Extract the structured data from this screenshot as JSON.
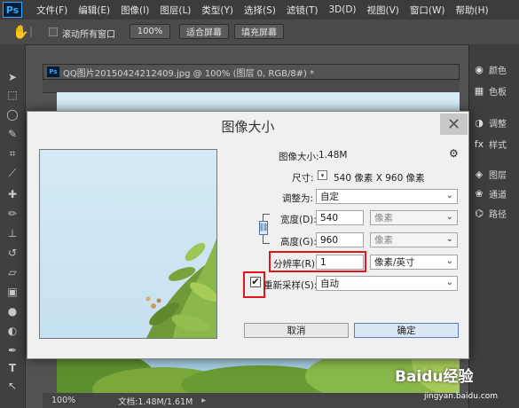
{
  "app": {
    "logo": "Ps"
  },
  "menu": [
    "文件(F)",
    "编辑(E)",
    "图像(I)",
    "图层(L)",
    "类型(Y)",
    "选择(S)",
    "滤镜(T)",
    "3D(D)",
    "视图(V)",
    "窗口(W)",
    "帮助(H)"
  ],
  "options_bar": {
    "scroll_all_label": "滚动所有窗口",
    "zoom_label": "100%",
    "fit_screen_label": "适合屏幕",
    "fill_screen_label": "填充屏幕"
  },
  "right_panels": [
    "颜色",
    "色板",
    "调整",
    "样式",
    "图层",
    "通道",
    "路径"
  ],
  "document": {
    "tab_title": "QQ图片20150424212409.jpg @ 100% (图层 0, RGB/8#) *",
    "status_zoom": "100%",
    "status_doc": "文档:1.48M/1.61M"
  },
  "dialog": {
    "title": "图像大小",
    "image_size_label": "图像大小:",
    "image_size_value": "1.48M",
    "dimensions_label": "尺寸:",
    "dimensions_value": "540 像素  X  960 像素",
    "fit_to_label": "调整为:",
    "fit_to_value": "自定",
    "width_label": "宽度(D):",
    "width_value": "540",
    "width_unit": "像素",
    "height_label": "高度(G):",
    "height_value": "960",
    "height_unit": "像素",
    "resolution_label": "分辨率(R):",
    "resolution_value": "1",
    "resolution_unit": "像素/英寸",
    "resample_label": "重新采样(S):",
    "resample_value": "自动",
    "resample_checked": true,
    "cancel_label": "取消",
    "ok_label": "确定"
  },
  "watermark": {
    "brand": "Baidu经验",
    "url": "jingyan.baidu.com"
  }
}
